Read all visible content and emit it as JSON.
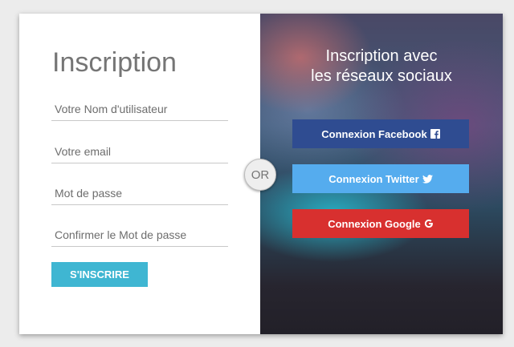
{
  "form": {
    "title": "Inscription",
    "username_placeholder": "Votre Nom d'utilisateur",
    "email_placeholder": "Votre email",
    "password_placeholder": "Mot de passe",
    "confirm_placeholder": "Confirmer le Mot de passe",
    "submit_label": "S'INSCRIRE"
  },
  "separator": {
    "label": "OR"
  },
  "social": {
    "title_line1": "Inscription avec",
    "title_line2": "les réseaux sociaux",
    "facebook_label": "Connexion Facebook",
    "twitter_label": "Connexion Twitter",
    "google_label": "Connexion Google"
  },
  "colors": {
    "submit": "#3fb6d2",
    "facebook": "#2f4c91",
    "twitter": "#55acee",
    "google": "#d8302f"
  },
  "icons": {
    "facebook": "facebook-icon",
    "twitter": "twitter-icon",
    "google": "google-icon"
  }
}
